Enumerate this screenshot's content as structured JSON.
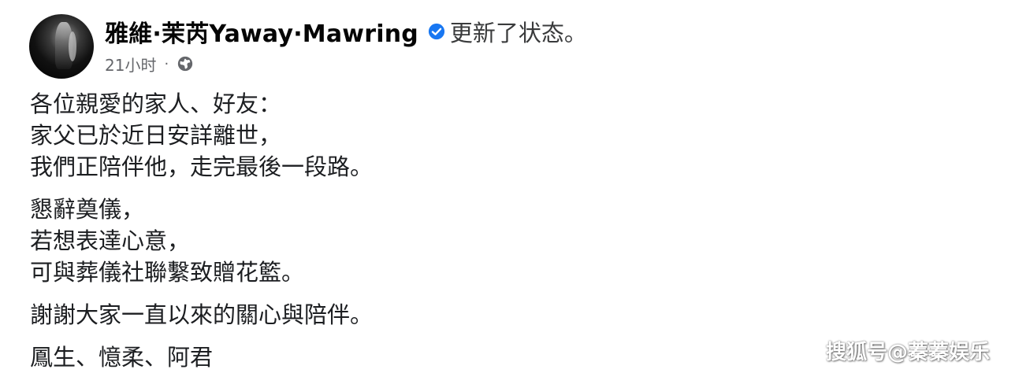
{
  "post": {
    "author": "雅維·茉芮Yaway·Mawring",
    "action": "更新了状态。",
    "timestamp": "21小时",
    "separator": "·",
    "verified_icon": "verified-badge-icon",
    "audience_icon": "globe-icon",
    "paragraphs": [
      [
        "各位親愛的家人、好友：",
        "家父已於近日安詳離世，",
        "我們正陪伴他，走完最後一段路。"
      ],
      [
        "懇辭奠儀，",
        "若想表達心意，",
        "可與葬儀社聯繫致贈花籃。"
      ],
      [
        "謝謝大家一直以來的關心與陪伴。"
      ],
      [
        "鳳生、憶柔、阿君"
      ]
    ]
  },
  "watermark": "搜狐号@蓁蓁娱乐",
  "colors": {
    "verified_blue": "#1877f2",
    "meta_gray": "#65676b",
    "text": "#1c1e21"
  }
}
